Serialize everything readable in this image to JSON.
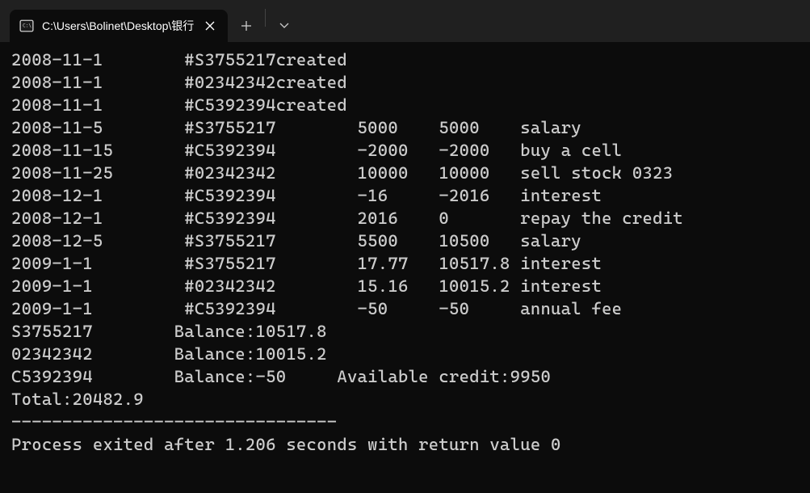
{
  "tab": {
    "title": "C:\\Users\\Bolinet\\Desktop\\银行"
  },
  "lines": [
    "2008-11-1        #S3755217created",
    "2008-11-1        #02342342created",
    "2008-11-1        #C5392394created",
    "2008-11-5        #S3755217        5000    5000    salary",
    "2008-11-15       #C5392394        -2000   -2000   buy a cell",
    "2008-11-25       #02342342        10000   10000   sell stock 0323",
    "2008-12-1        #C5392394        -16     -2016   interest",
    "2008-12-1        #C5392394        2016    0       repay the credit",
    "2008-12-5        #S3755217        5500    10500   salary",
    "2009-1-1         #S3755217        17.77   10517.8 interest",
    "2009-1-1         #02342342        15.16   10015.2 interest",
    "2009-1-1         #C5392394        -50     -50     annual fee",
    "",
    "S3755217        Balance:10517.8",
    "02342342        Balance:10015.2",
    "C5392394        Balance:-50     Available credit:9950",
    "Total:20482.9",
    "",
    "--------------------------------",
    "Process exited after 1.206 seconds with return value 0"
  ]
}
